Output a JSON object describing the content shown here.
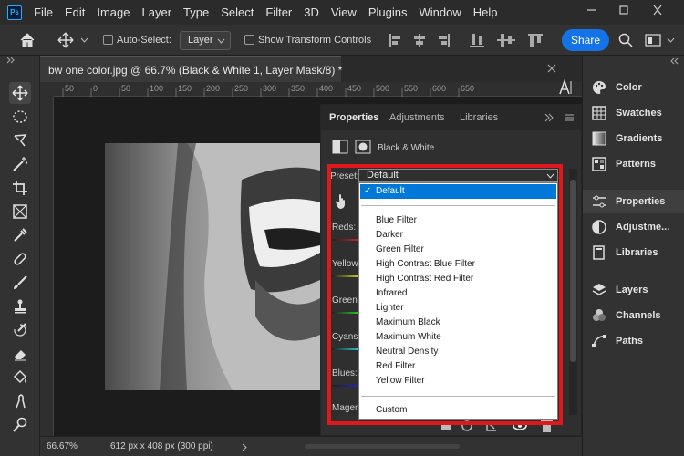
{
  "app": {
    "logo_text": "Ps"
  },
  "menu": [
    "File",
    "Edit",
    "Image",
    "Layer",
    "Type",
    "Select",
    "Filter",
    "3D",
    "View",
    "Plugins",
    "Window",
    "Help"
  ],
  "options_bar": {
    "auto_select_label": "Auto-Select:",
    "layer_select_value": "Layer",
    "show_transform_label": "Show Transform Controls",
    "share_label": "Share"
  },
  "document": {
    "tab_title": "bw one color.jpg @ 66.7% (Black & White 1, Layer Mask/8) *",
    "ruler_ticks": [
      "50",
      "0",
      "50",
      "100",
      "150",
      "200",
      "250",
      "300",
      "350",
      "400",
      "450",
      "500",
      "550",
      "600",
      "650"
    ]
  },
  "status": {
    "zoom": "66.67%",
    "doc_info": "612 px x 408 px (300 ppi)"
  },
  "properties": {
    "tabs": [
      "Properties",
      "Adjustments",
      "Libraries"
    ],
    "adjustment_title": "Black & White",
    "preset_label": "Preset:",
    "preset_value": "Default",
    "channels": [
      "Reds:",
      "Yellows:",
      "Greens:",
      "Cyans:",
      "Blues:",
      "Magentas:"
    ]
  },
  "preset_options": {
    "selected": "Default",
    "list": [
      "Default",
      "Blue Filter",
      "Darker",
      "Green Filter",
      "High Contrast Blue Filter",
      "High Contrast Red Filter",
      "Infrared",
      "Lighter",
      "Maximum Black",
      "Maximum White",
      "Neutral Density",
      "Red Filter",
      "Yellow Filter",
      "Custom"
    ]
  },
  "right_dock": {
    "items": [
      "Color",
      "Swatches",
      "Gradients",
      "Patterns",
      "Properties",
      "Adjustme...",
      "Libraries",
      "Layers",
      "Channels",
      "Paths"
    ],
    "active": "Properties"
  },
  "colors": {
    "accent": "#1473e6",
    "highlight_box": "#e0181c",
    "selected_option": "#0078d7"
  },
  "icons": {
    "tools": [
      "move-icon",
      "ellipse-marquee-icon",
      "lasso-icon",
      "magic-wand-icon",
      "crop-icon",
      "frame-icon",
      "eyedropper-icon",
      "healing-brush-icon",
      "brush-icon",
      "clone-stamp-icon",
      "history-brush-icon",
      "eraser-icon",
      "paint-bucket-icon",
      "smudge-icon",
      "dodge-icon"
    ]
  }
}
